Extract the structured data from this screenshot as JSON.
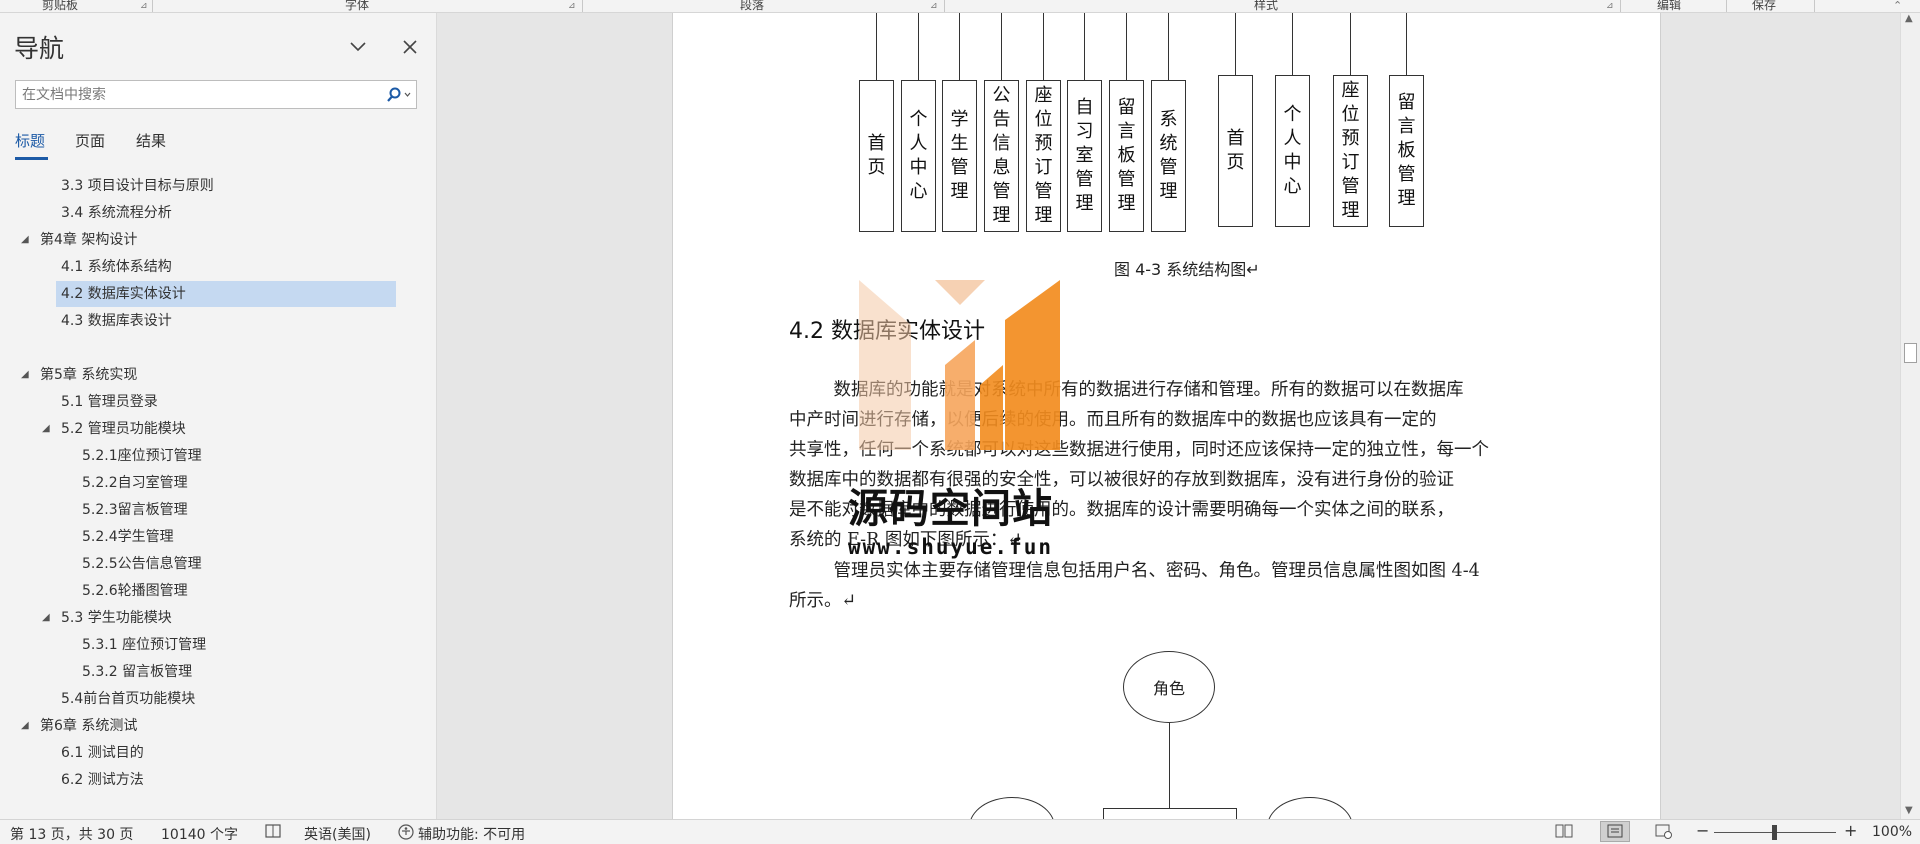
{
  "ribbon": {
    "groups": [
      "剪贴板",
      "字体",
      "段落",
      "样式",
      "编辑",
      "保存"
    ]
  },
  "nav": {
    "title": "导航",
    "search_placeholder": "在文档中搜索",
    "tabs": [
      "标题",
      "页面",
      "结果"
    ],
    "items": [
      {
        "label": "3.3  项目设计目标与原则",
        "level": 2,
        "tw": ""
      },
      {
        "label": "3.4  系统流程分析",
        "level": 2,
        "tw": ""
      },
      {
        "label": "第4章  架构设计",
        "level": 1,
        "tw": "◢"
      },
      {
        "label": "4.1  系统体系结构",
        "level": 2,
        "tw": ""
      },
      {
        "label": "4.2  数据库实体设计",
        "level": 2,
        "tw": "",
        "selected": true
      },
      {
        "label": "4.3  数据库表设计",
        "level": 2,
        "tw": ""
      },
      {
        "label": "",
        "level": 1,
        "tw": ""
      },
      {
        "label": "第5章  系统实现",
        "level": 1,
        "tw": "◢"
      },
      {
        "label": "5.1 管理员登录",
        "level": 2,
        "tw": ""
      },
      {
        "label": "5.2  管理员功能模块",
        "level": 2,
        "tw": "◢"
      },
      {
        "label": "5.2.1座位预订管理",
        "level": 3,
        "tw": ""
      },
      {
        "label": "5.2.2自习室管理",
        "level": 3,
        "tw": ""
      },
      {
        "label": "5.2.3留言板管理",
        "level": 3,
        "tw": ""
      },
      {
        "label": "5.2.4学生管理",
        "level": 3,
        "tw": ""
      },
      {
        "label": "5.2.5公告信息管理",
        "level": 3,
        "tw": ""
      },
      {
        "label": "5.2.6轮播图管理",
        "level": 3,
        "tw": ""
      },
      {
        "label": "5.3  学生功能模块",
        "level": 2,
        "tw": "◢"
      },
      {
        "label": "5.3.1 座位预订管理",
        "level": 3,
        "tw": ""
      },
      {
        "label": "5.3.2 留言板管理",
        "level": 3,
        "tw": ""
      },
      {
        "label": "5.4前台首页功能模块",
        "level": 2,
        "tw": ""
      },
      {
        "label": "第6章  系统测试",
        "level": 1,
        "tw": "◢"
      },
      {
        "label": "6.1  测试目的",
        "level": 2,
        "tw": ""
      },
      {
        "label": "6.2  测试方法",
        "level": 2,
        "tw": ""
      }
    ]
  },
  "document": {
    "diagram_left": [
      "首页",
      "个人中心",
      "学生管理",
      "公告信息管理",
      "座位预订管理",
      "自习室管理",
      "留言板管理",
      "系统管理"
    ],
    "diagram_right": [
      "首页",
      "个人中心",
      "座位预订管理",
      "留言板管理"
    ],
    "figure_caption": "图 4-3  系统结构图↵",
    "section_heading": "4.2   数据库实体设计",
    "paragraph1_lines": [
      "        数据库的功能就是对系统中所有的数据进行存储和管理。所有的数据可以在数据库",
      "中产时间进行存储，以便后续的使用。而且所有的数据库中的数据也应该具有一定的",
      "共享性，任何一个系统都可以对这些数据进行使用，同时还应该保持一定的独立性，每一个",
      "数据库中的数据都有很强的安全性，可以被很好的存放到数据库，没有进行身份的验证",
      "是不能对数据库中的数据进行使用的。数据库的设计需要明确每一个实体之间的联系，",
      "系统的 E-R 图如下图所示：↵"
    ],
    "paragraph2_lines": [
      "        管理员实体主要存储管理信息包括用户名、密码、角色。管理员信息属性图如图 4-4",
      "所示。↵"
    ],
    "er_attribute": "角色",
    "watermark_text": "源码空间站",
    "watermark_url": "www.shuyue.fun"
  },
  "status": {
    "page": "第 13 页，共 30 页",
    "words": "10140 个字",
    "language": "英语(美国)",
    "accessibility": "辅助功能: 不可用",
    "zoom": "100%"
  },
  "colors": {
    "accent": "#1c5aa6",
    "selected_bg": "#c5d9f1",
    "watermark_orange": "#f28c1e",
    "watermark_peach": "#f4c9a6"
  }
}
